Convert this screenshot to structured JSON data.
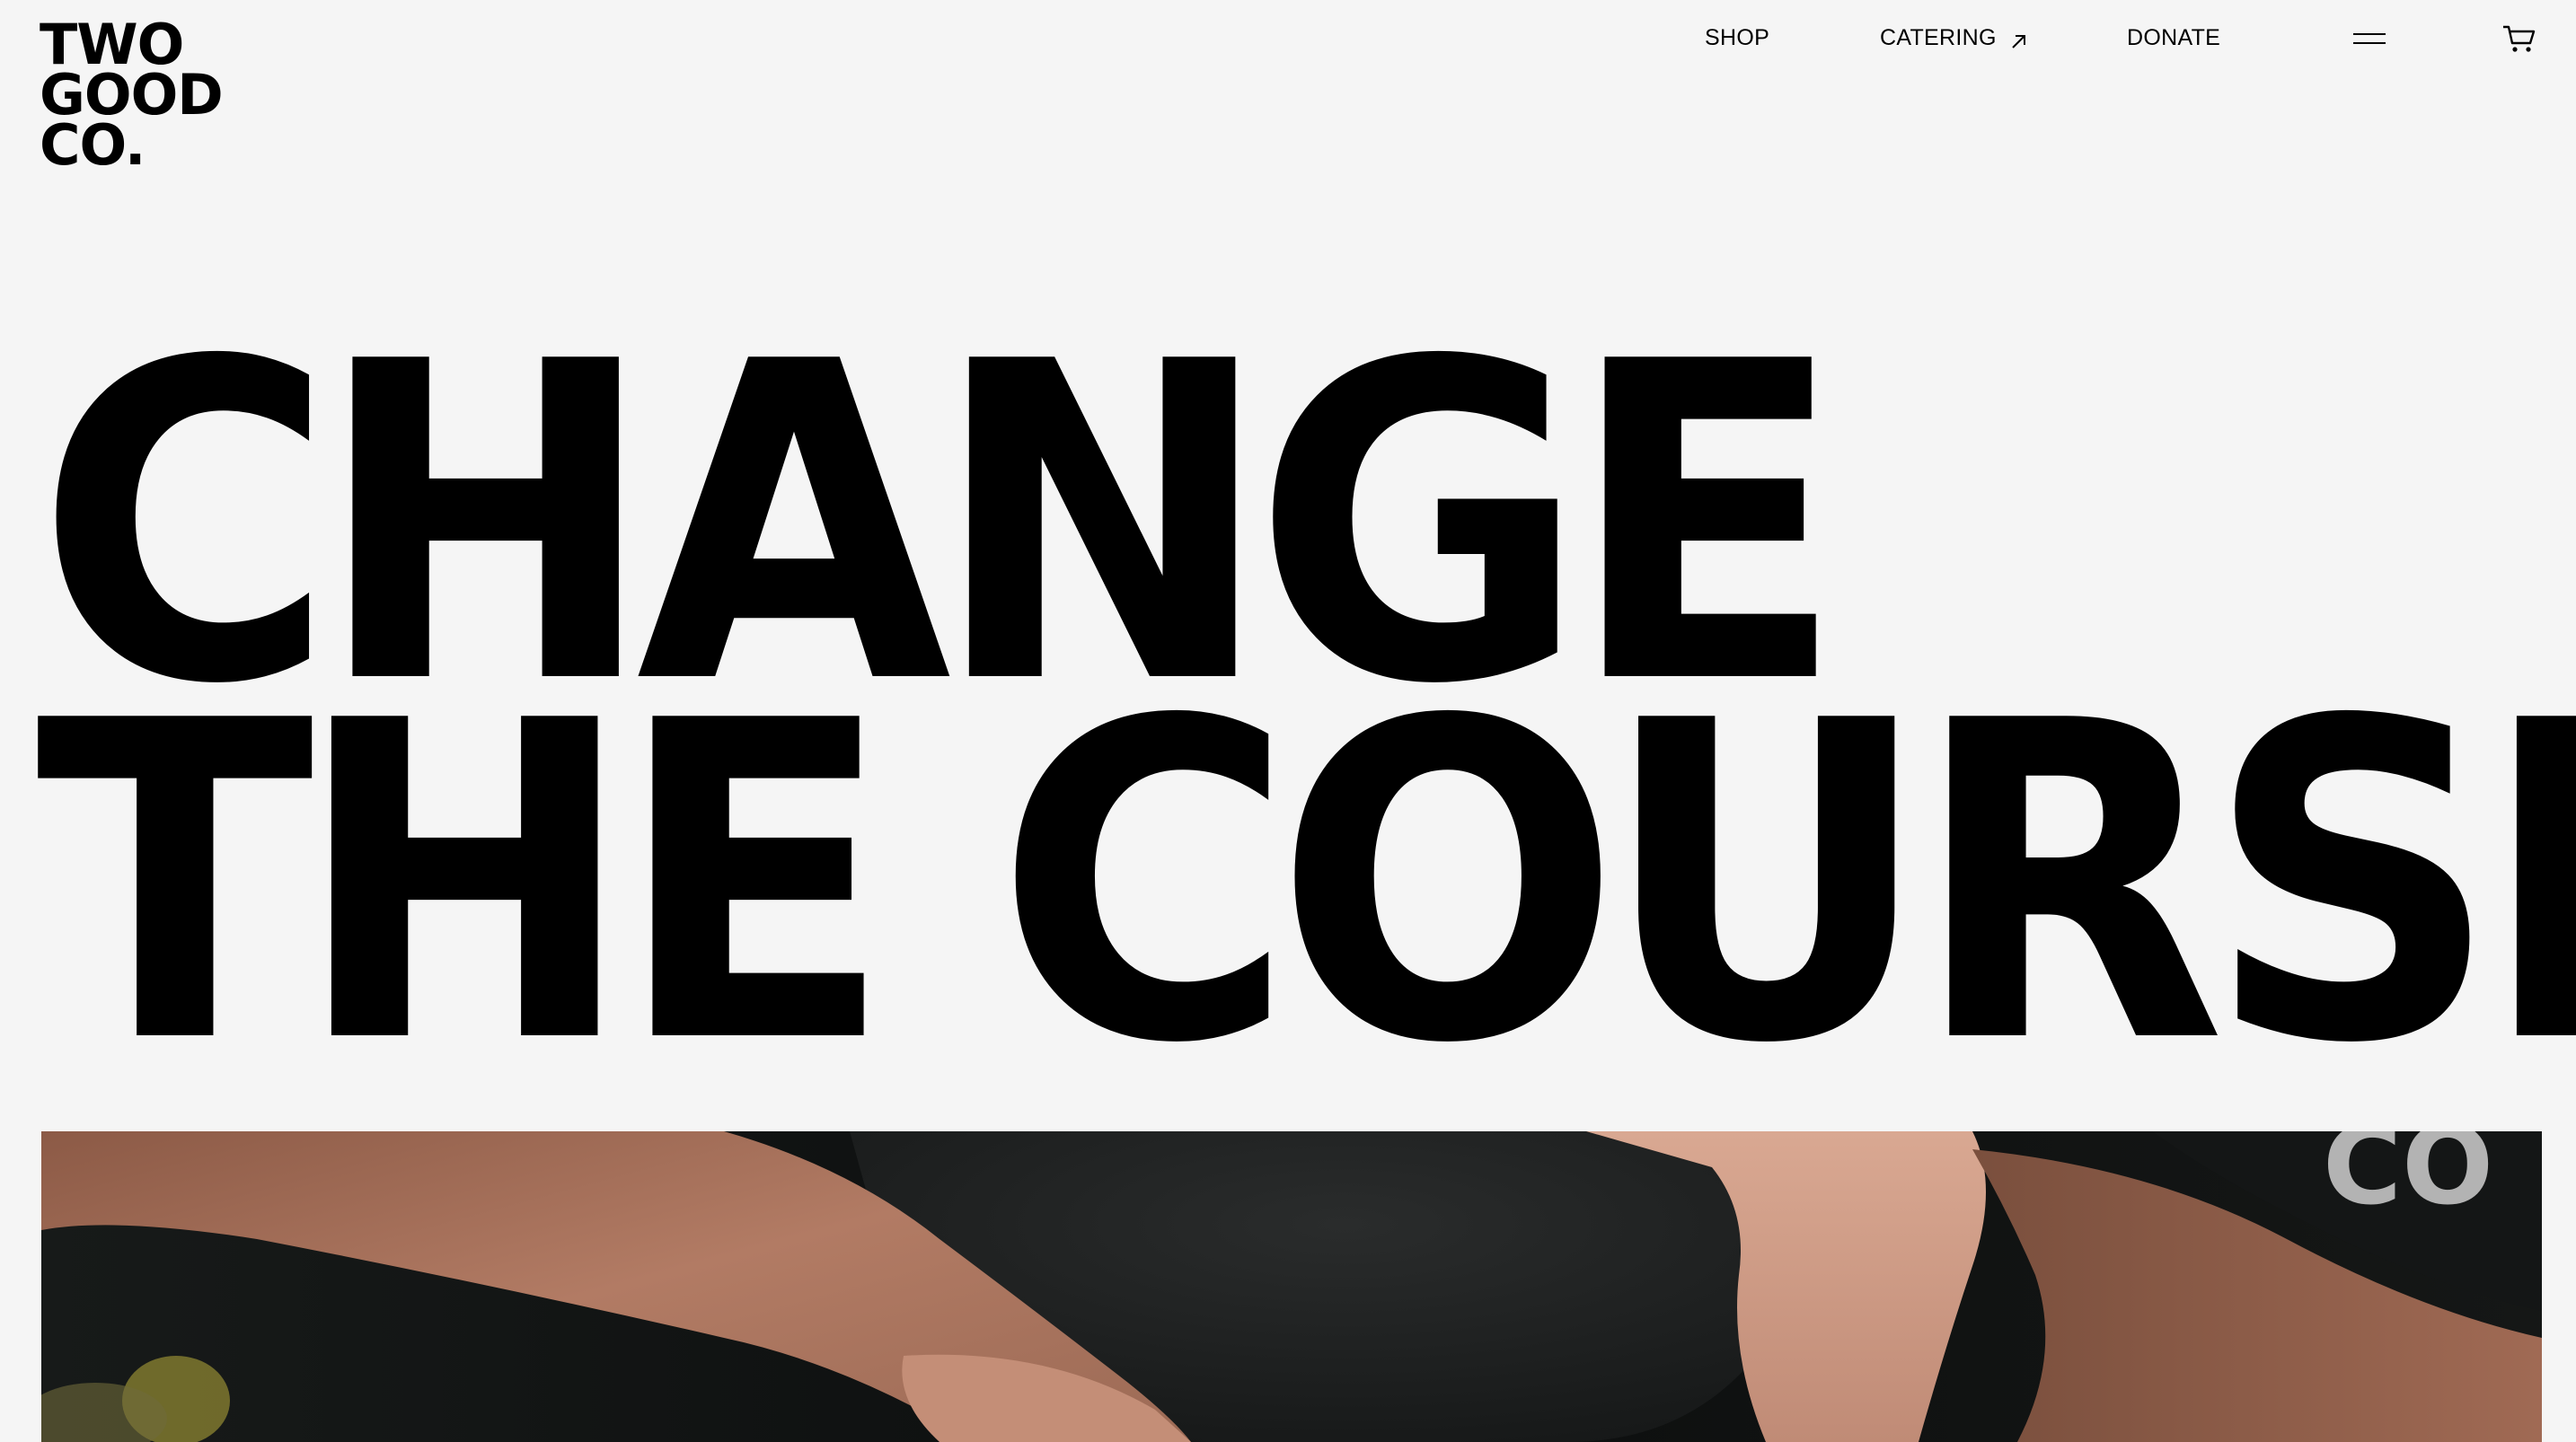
{
  "logo": {
    "lines": [
      "TWO",
      "GOOD",
      "CO."
    ]
  },
  "nav": {
    "shop": "SHOP",
    "catering": "CATERING",
    "donate": "DONATE"
  },
  "icons": {
    "catering_arrow": "arrow-up-right-icon",
    "menu": "hamburger-menu-icon",
    "cart": "cart-icon"
  },
  "hero": {
    "headline_line1": "CHANGE",
    "headline_line2": "THE COURSE"
  }
}
